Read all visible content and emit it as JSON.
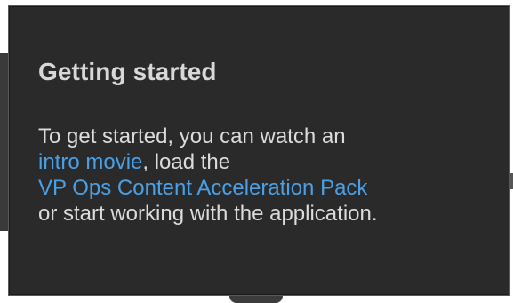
{
  "popover": {
    "title": "Getting started",
    "line1": "To get started, you can watch an",
    "intro_link": "intro movie",
    "line2_rest": ", load the",
    "pack_link": "VP Ops Content Acceleration Pack",
    "line4": "or start working with the application."
  },
  "colors": {
    "panel_background": "#2a2a2a",
    "text": "#dcdcdc",
    "link": "#4aa0e6"
  }
}
